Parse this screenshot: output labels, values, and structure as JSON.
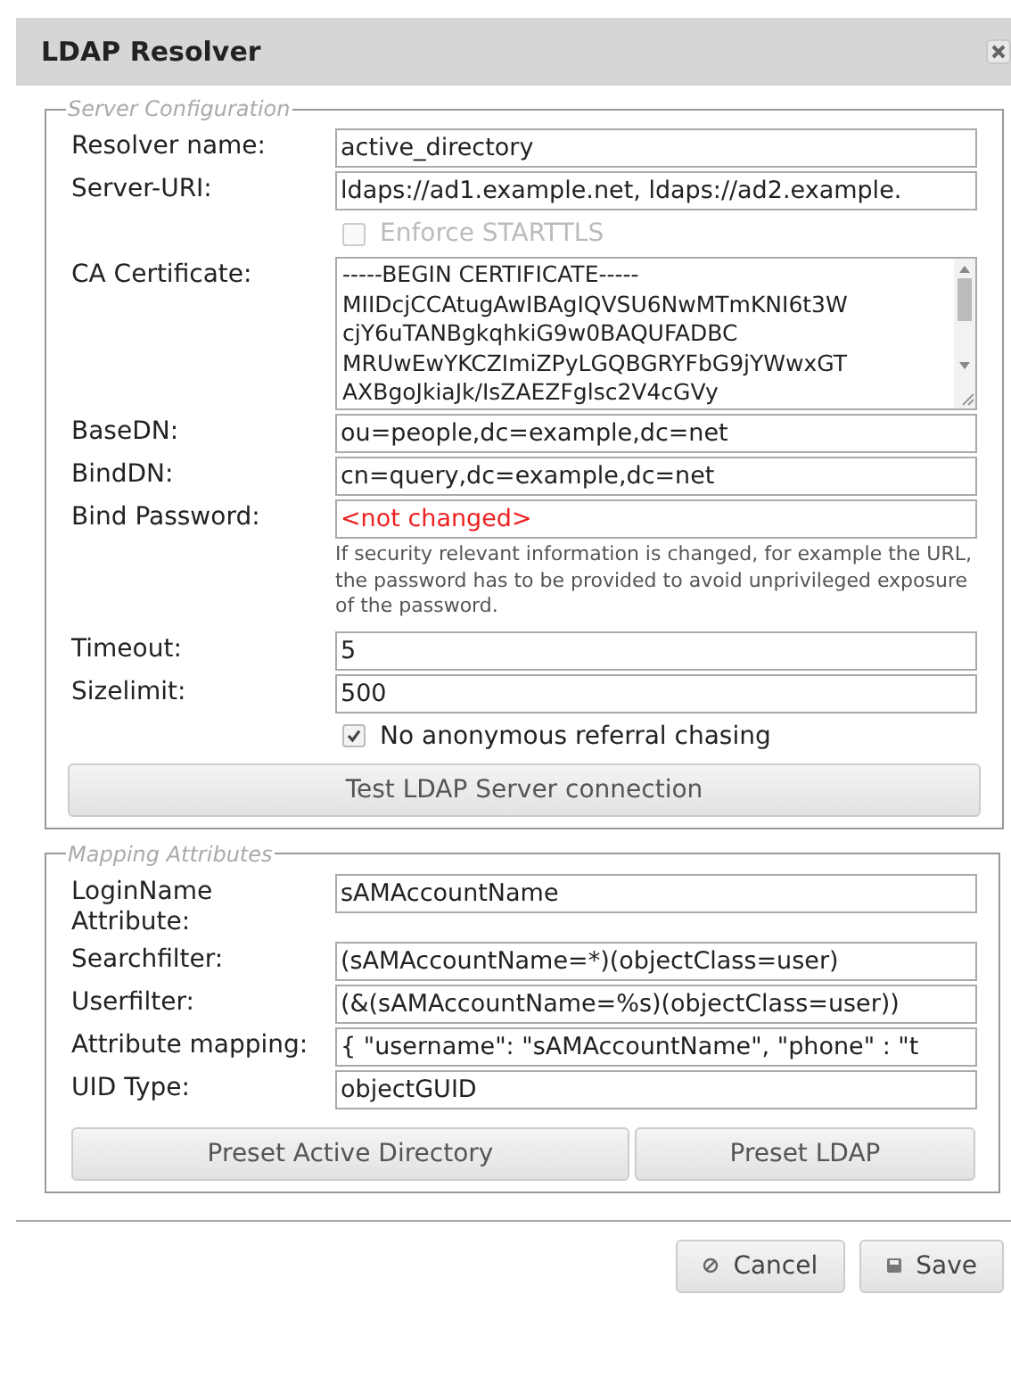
{
  "dialog": {
    "title": "LDAP Resolver"
  },
  "server_configuration": {
    "legend": "Server Configuration",
    "rows": [
      {
        "kind": "input",
        "label": "Resolver name:",
        "value": "active_directory"
      },
      {
        "kind": "input",
        "label": "Server-URI:",
        "value": "ldaps://ad1.example.net, ldaps://ad2.example."
      },
      {
        "kind": "checkbox",
        "label": "Enforce STARTTLS",
        "checked": false,
        "disabled": true
      },
      {
        "kind": "textarea",
        "label": "CA Certificate:",
        "lines": [
          "-----BEGIN CERTIFICATE-----",
          "MIIDcjCCAtugAwIBAgIQVSU6NwMTmKNI6t3W",
          "cjY6uTANBgkqhkiG9w0BAQUFADBC",
          "MRUwEwYKCZImiZPyLGQBGRYFbG9jYWwxGT",
          "AXBgoJkiaJk/IsZAEZFglsc2V4cGVy"
        ]
      },
      {
        "kind": "input",
        "label": "BaseDN:",
        "value": "ou=people,dc=example,dc=net"
      },
      {
        "kind": "input",
        "label": "BindDN:",
        "value": "cn=query,dc=example,dc=net"
      },
      {
        "kind": "password",
        "label": "Bind Password:",
        "value": "<not changed>",
        "hint": "If security relevant information is changed, for example the URL, the password has to be provided to avoid unprivileged exposure of the password."
      },
      {
        "kind": "input",
        "label": "Timeout:",
        "value": "5"
      },
      {
        "kind": "input",
        "label": "Sizelimit:",
        "value": "500"
      },
      {
        "kind": "checkbox",
        "label": "No anonymous referral chasing",
        "checked": true,
        "disabled": false
      }
    ],
    "test_button": "Test LDAP Server connection"
  },
  "mapping_attributes": {
    "legend": "Mapping Attributes",
    "rows": [
      {
        "kind": "input",
        "label": "LoginName Attribute:",
        "value": "sAMAccountName"
      },
      {
        "kind": "input",
        "label": "Searchfilter:",
        "value": "(sAMAccountName=*)(objectClass=user)"
      },
      {
        "kind": "input",
        "label": "Userfilter:",
        "value": "(&(sAMAccountName=%s)(objectClass=user))"
      },
      {
        "kind": "input",
        "label": "Attribute mapping:",
        "value": "{ \"username\": \"sAMAccountName\", \"phone\" : \"t"
      },
      {
        "kind": "input",
        "label": "UID Type:",
        "value": "objectGUID"
      }
    ],
    "buttons": [
      "Preset Active Directory",
      "Preset LDAP"
    ]
  },
  "footer": {
    "cancel": "Cancel",
    "save": "Save"
  }
}
